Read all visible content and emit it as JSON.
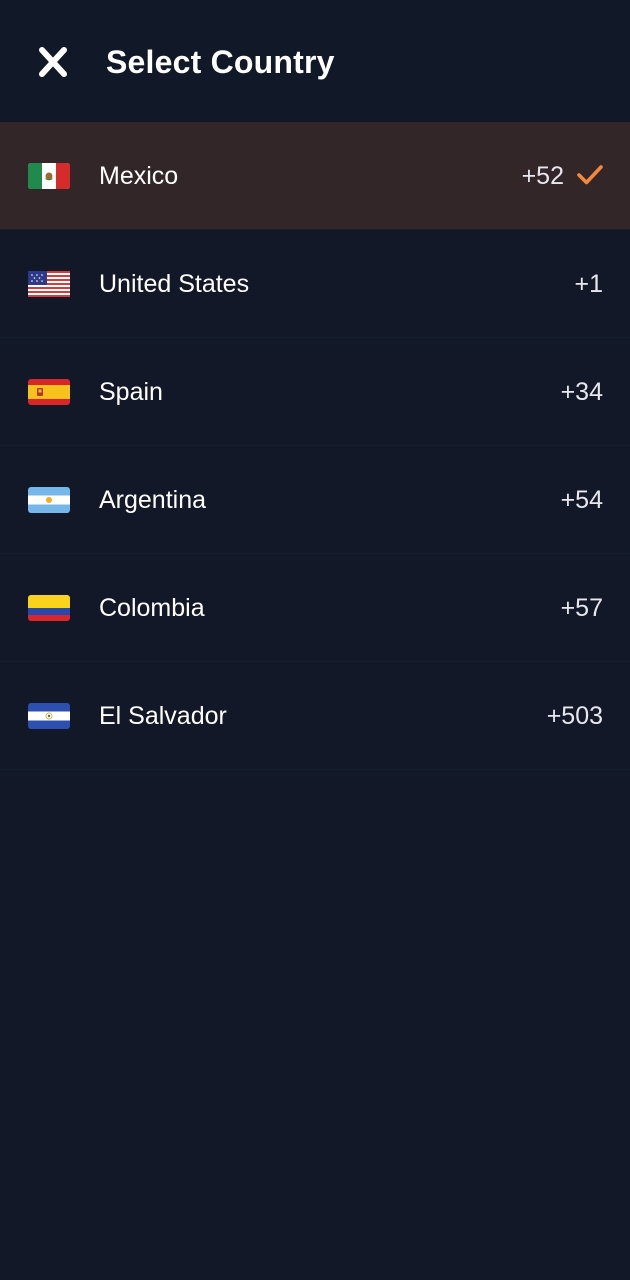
{
  "header": {
    "title": "Select Country",
    "close_icon": "close-icon"
  },
  "accent_color": "#F5873A",
  "selected_row_color": "#332629",
  "countries": [
    {
      "name": "Mexico",
      "code": "+52",
      "flag": "mexico-flag-icon",
      "selected": true
    },
    {
      "name": "United States",
      "code": "+1",
      "flag": "united-states-flag-icon",
      "selected": false
    },
    {
      "name": "Spain",
      "code": "+34",
      "flag": "spain-flag-icon",
      "selected": false
    },
    {
      "name": "Argentina",
      "code": "+54",
      "flag": "argentina-flag-icon",
      "selected": false
    },
    {
      "name": "Colombia",
      "code": "+57",
      "flag": "colombia-flag-icon",
      "selected": false
    },
    {
      "name": "El Salvador",
      "code": "+503",
      "flag": "el-salvador-flag-icon",
      "selected": false
    }
  ]
}
